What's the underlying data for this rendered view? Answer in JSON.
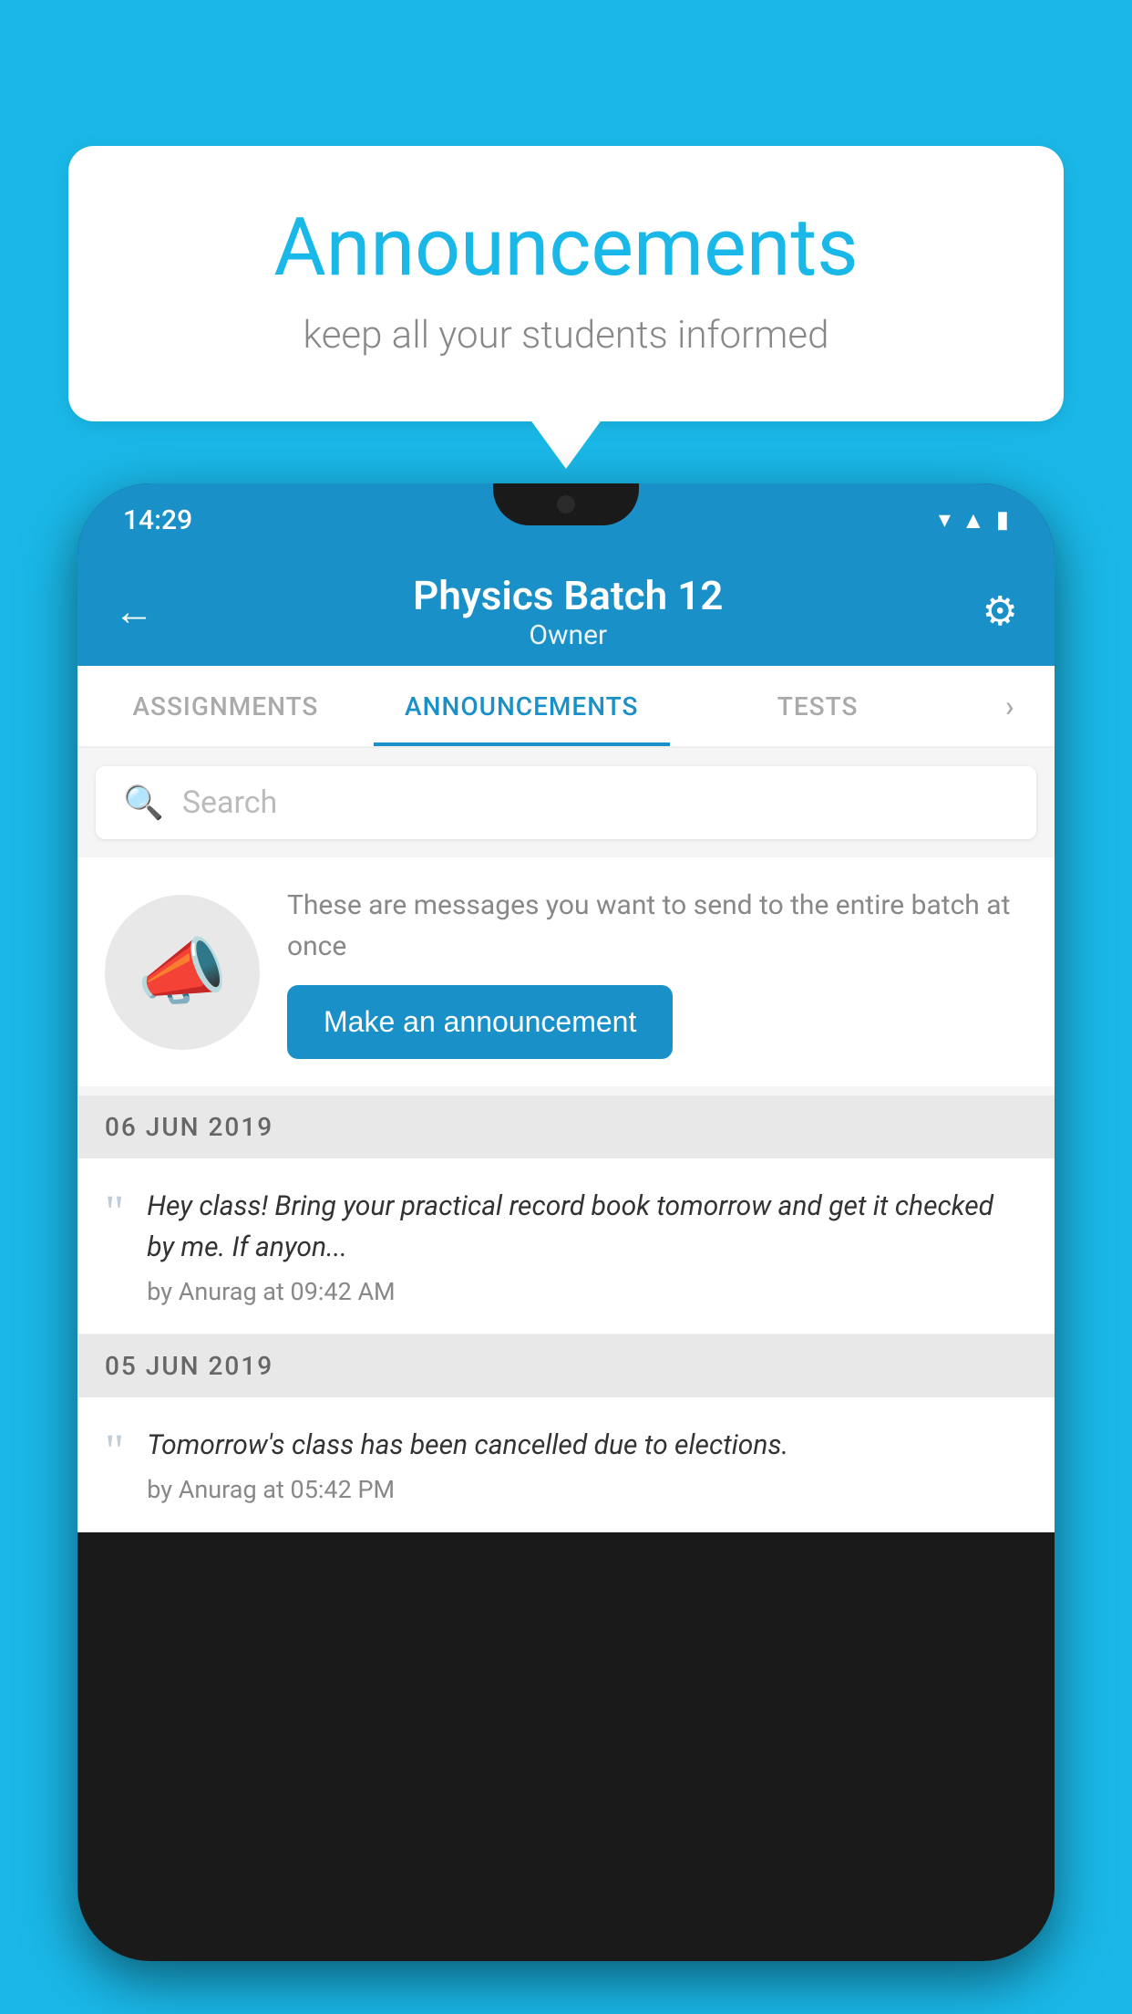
{
  "background_color": "#1ab8e8",
  "speech_bubble": {
    "title": "Announcements",
    "subtitle": "keep all your students informed"
  },
  "phone": {
    "status_bar": {
      "time": "14:29"
    },
    "header": {
      "title": "Physics Batch 12",
      "subtitle": "Owner",
      "back_label": "←",
      "gear_label": "⚙"
    },
    "tabs": [
      {
        "label": "ASSIGNMENTS",
        "active": false
      },
      {
        "label": "ANNOUNCEMENTS",
        "active": true
      },
      {
        "label": "TESTS",
        "active": false
      },
      {
        "label": "...",
        "active": false
      }
    ],
    "search": {
      "placeholder": "Search"
    },
    "promo": {
      "description": "These are messages you want to send to the entire batch at once",
      "button_label": "Make an announcement"
    },
    "announcements": [
      {
        "date": "06  JUN  2019",
        "text": "Hey class! Bring your practical record book tomorrow and get it checked by me. If anyon...",
        "author": "by Anurag at 09:42 AM"
      },
      {
        "date": "05  JUN  2019",
        "text": "Tomorrow's class has been cancelled due to elections.",
        "author": "by Anurag at 05:42 PM"
      }
    ]
  }
}
